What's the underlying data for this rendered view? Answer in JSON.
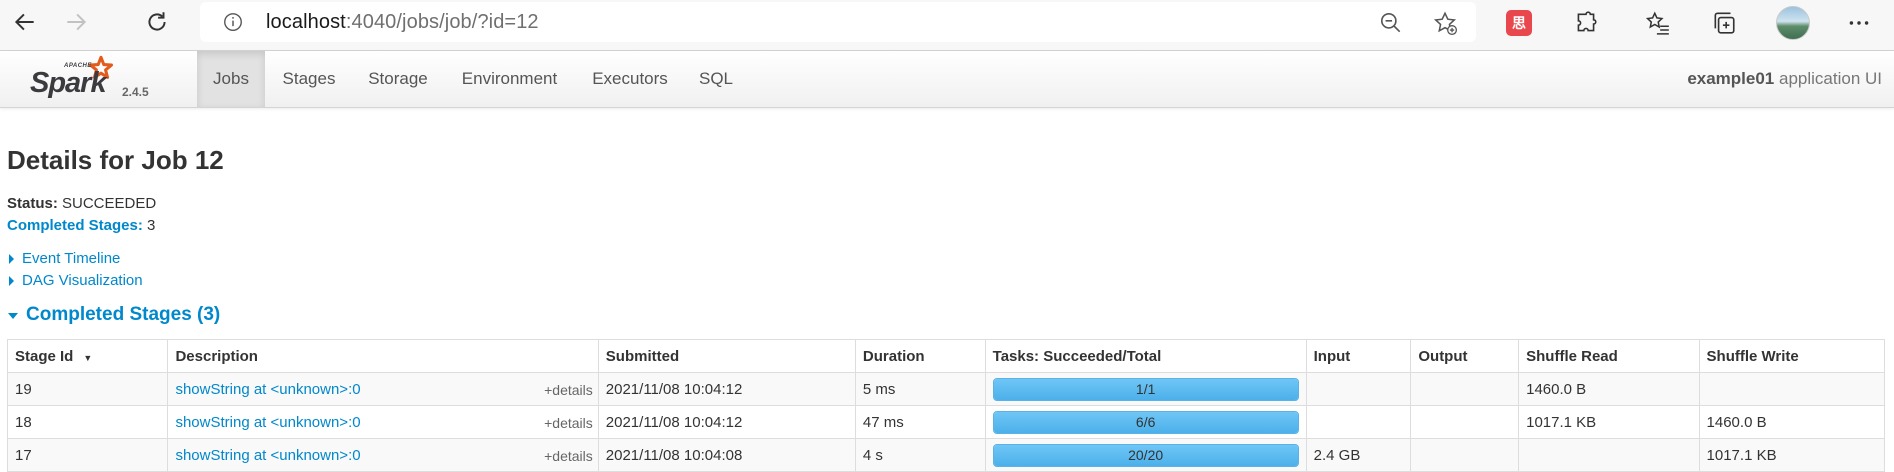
{
  "browser": {
    "url_host": "localhost",
    "url_path": ":4040/jobs/job/?id=12",
    "extension_badge": "思"
  },
  "spark": {
    "brand_apache": "APACHE",
    "brand_name": "Spark",
    "version": "2.4.5",
    "tabs": [
      {
        "label": "Jobs",
        "active": true
      },
      {
        "label": "Stages"
      },
      {
        "label": "Storage"
      },
      {
        "label": "Environment"
      },
      {
        "label": "Executors"
      },
      {
        "label": "SQL"
      }
    ],
    "app_name": "example01",
    "app_suffix": " application UI"
  },
  "page": {
    "title": "Details for Job 12",
    "status_label": "Status:",
    "status_value": " SUCCEEDED",
    "completed_label": "Completed Stages:",
    "completed_value": " 3",
    "event_timeline": "Event Timeline",
    "dag_visualization": "DAG Visualization",
    "section_title": "Completed Stages (3)"
  },
  "table": {
    "headers": [
      "Stage Id",
      "Description",
      "Submitted",
      "Duration",
      "Tasks: Succeeded/Total",
      "Input",
      "Output",
      "Shuffle Read",
      "Shuffle Write"
    ],
    "sort_indicator": "▼",
    "details_label": "+details",
    "rows": [
      {
        "stage_id": "19",
        "description": "showString at <unknown>:0",
        "submitted": "2021/11/08 10:04:12",
        "duration": "5 ms",
        "tasks": "1/1",
        "tasks_fraction": 1,
        "input": "",
        "output": "",
        "shuffle_read": "1460.0 B",
        "shuffle_write": ""
      },
      {
        "stage_id": "18",
        "description": "showString at <unknown>:0",
        "submitted": "2021/11/08 10:04:12",
        "duration": "47 ms",
        "tasks": "6/6",
        "tasks_fraction": 1,
        "input": "",
        "output": "",
        "shuffle_read": "1017.1 KB",
        "shuffle_write": "1460.0 B"
      },
      {
        "stage_id": "17",
        "description": "showString at <unknown>:0",
        "submitted": "2021/11/08 10:04:08",
        "duration": "4 s",
        "tasks": "20/20",
        "tasks_fraction": 1,
        "input": "2.4 GB",
        "output": "",
        "shuffle_read": "",
        "shuffle_write": "1017.1 KB"
      }
    ]
  },
  "colors": {
    "link": "#0088cc",
    "progress": "#4cb0ea"
  }
}
